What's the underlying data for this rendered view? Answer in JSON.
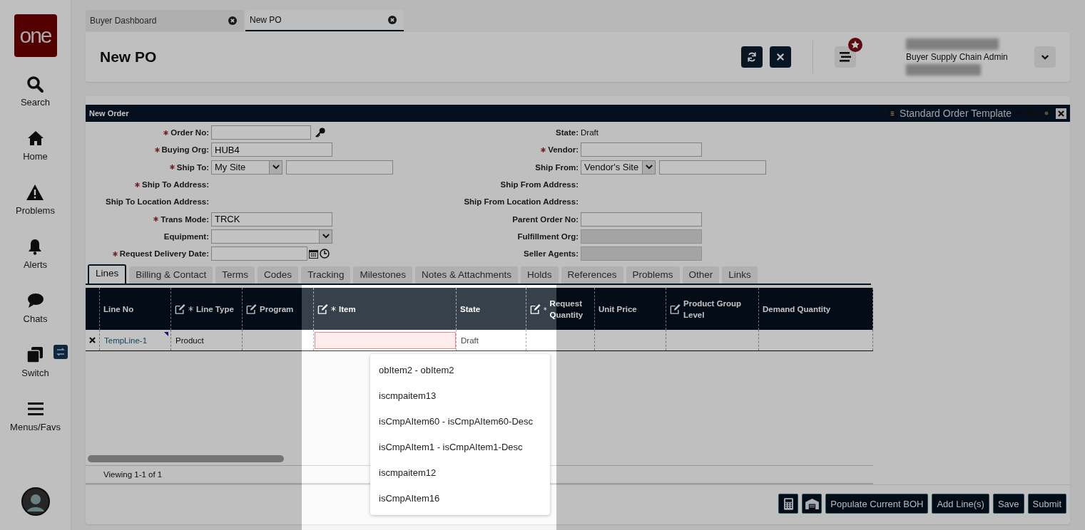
{
  "sidebar": {
    "logo": "one",
    "items": [
      {
        "kind": "search",
        "label": "Search"
      },
      {
        "kind": "home",
        "label": "Home"
      },
      {
        "kind": "problems",
        "label": "Problems"
      },
      {
        "kind": "alerts",
        "label": "Alerts"
      },
      {
        "kind": "chats",
        "label": "Chats"
      },
      {
        "kind": "switch",
        "label": "Switch"
      },
      {
        "kind": "menus",
        "label": "Menus/Favs"
      }
    ]
  },
  "page_tabs": [
    {
      "label": "Buyer Dashboard",
      "selected": false
    },
    {
      "label": "New PO",
      "selected": true
    }
  ],
  "header": {
    "title": "New PO",
    "user_role": "Buyer Supply Chain Admin"
  },
  "panel": {
    "title": "New Order",
    "template": "Standard Order Template"
  },
  "form_left": [
    {
      "label": "Order No:",
      "required": true,
      "kind": "lookup"
    },
    {
      "label": "Buying Org:",
      "required": true,
      "kind": "text",
      "value": "HUB4"
    },
    {
      "label": "Ship To:",
      "required": true,
      "kind": "select_text",
      "value": "My Site"
    },
    {
      "label": "Ship To Address:",
      "required": true,
      "kind": "none"
    },
    {
      "label": "Ship To Location Address:",
      "required": false,
      "kind": "none"
    },
    {
      "label": "Trans Mode:",
      "required": true,
      "kind": "text",
      "value": "TRCK"
    },
    {
      "label": "Equipment:",
      "required": false,
      "kind": "select"
    },
    {
      "label": "Request Delivery Date:",
      "required": true,
      "kind": "date"
    }
  ],
  "form_right": [
    {
      "label": "State:",
      "required": false,
      "kind": "static",
      "value": "Draft"
    },
    {
      "label": "Vendor:",
      "required": true,
      "kind": "text"
    },
    {
      "label": "Ship From:",
      "required": false,
      "kind": "select_text",
      "value": "Vendor's Site"
    },
    {
      "label": "Ship From Address:",
      "required": false,
      "kind": "none"
    },
    {
      "label": "Ship From Location Address:",
      "required": false,
      "kind": "none"
    },
    {
      "label": "Parent Order No:",
      "required": false,
      "kind": "text"
    },
    {
      "label": "Fulfillment Org:",
      "required": false,
      "kind": "disabled"
    },
    {
      "label": "Seller Agents:",
      "required": false,
      "kind": "disabled"
    }
  ],
  "sub_tabs": [
    {
      "label": "Lines",
      "selected": true
    },
    {
      "label": "Billing & Contact",
      "selected": false
    },
    {
      "label": "Terms",
      "selected": false
    },
    {
      "label": "Codes",
      "selected": false
    },
    {
      "label": "Tracking",
      "selected": false
    },
    {
      "label": "Milestones",
      "selected": false
    },
    {
      "label": "Notes & Attachments",
      "selected": false
    },
    {
      "label": "Holds",
      "selected": false
    },
    {
      "label": "References",
      "selected": false
    },
    {
      "label": "Problems",
      "selected": false
    },
    {
      "label": "Other",
      "selected": false
    },
    {
      "label": "Links",
      "selected": false
    }
  ],
  "table": {
    "columns": [
      {
        "label": "Line No",
        "editable": false,
        "required": false
      },
      {
        "label": "Line Type",
        "editable": true,
        "required": true
      },
      {
        "label": "Program",
        "editable": true,
        "required": false
      },
      {
        "label": "Item",
        "editable": true,
        "required": true
      },
      {
        "label": "State",
        "editable": false,
        "required": false
      },
      {
        "label": "Request Quantity",
        "editable": true,
        "required": true
      },
      {
        "label": "Unit Price",
        "editable": false,
        "required": false
      },
      {
        "label": "Product Group Level",
        "editable": true,
        "required": false
      },
      {
        "label": "Demand Quantity",
        "editable": false,
        "required": false
      }
    ],
    "rows": [
      {
        "cells": [
          "TempLine-1",
          "Product",
          "",
          "",
          "Draft",
          "",
          "",
          "",
          ""
        ]
      }
    ],
    "item_dropdown": [
      "obItem2 - obItem2",
      "iscmpaitem13",
      "isCmpAItem60 - isCmpAItem60-Desc",
      "isCmpAItem1 - isCmpAItem1-Desc",
      "iscmpaitem12",
      "isCmpAItem16"
    ],
    "footer": "Viewing 1-1 of 1"
  },
  "buttons": [
    "Populate Current BOH",
    "Add Line(s)",
    "Save",
    "Submit"
  ]
}
